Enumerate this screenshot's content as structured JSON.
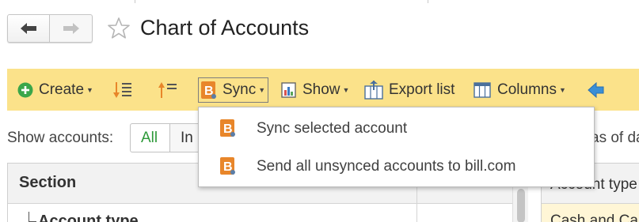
{
  "header": {
    "title": "Chart of Accounts",
    "back_icon": "arrow-left-icon",
    "forward_icon": "arrow-right-icon",
    "favorite_icon": "star-outline-icon"
  },
  "toolbar": {
    "create_label": "Create",
    "sync_label": "Sync",
    "show_label": "Show",
    "export_label": "Export list",
    "columns_label": "Columns",
    "icons": [
      "plus-circle-icon",
      "sort-descending-icon",
      "sort-ascending-icon",
      "billcom-icon",
      "report-icon",
      "export-icon",
      "columns-icon",
      "arrow-left-icon"
    ],
    "background_color": "#fbe28a"
  },
  "sync_menu": {
    "items": [
      {
        "label": "Sync selected account",
        "icon": "billcom-icon"
      },
      {
        "label": "Send all unsynced accounts to bill.com",
        "icon": "billcom-icon"
      }
    ]
  },
  "filter": {
    "label": "Show accounts:",
    "options": [
      "All",
      "In"
    ],
    "selected": "All",
    "as_of_text": "as of da"
  },
  "left_table": {
    "header": "Section",
    "row_label": "Account type"
  },
  "right_table": {
    "header": "Account type",
    "row_value": "Cash and Ca"
  },
  "colors": {
    "accent_green": "#2e9a3a",
    "billcom_orange": "#e8862a",
    "selected_row": "#fff6d6"
  }
}
